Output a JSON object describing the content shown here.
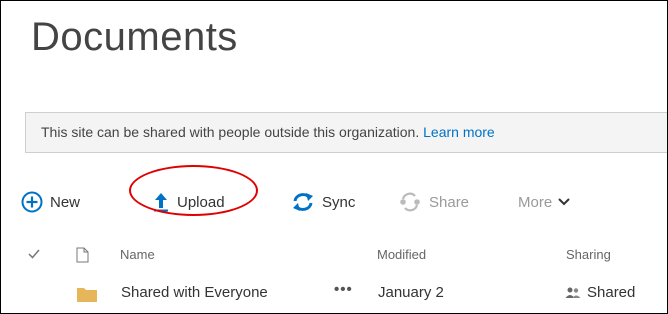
{
  "page": {
    "title": "Documents"
  },
  "banner": {
    "message": "This site can be shared with people outside this organization.",
    "link_label": "Learn more"
  },
  "toolbar": {
    "new_label": "New",
    "upload_label": "Upload",
    "sync_label": "Sync",
    "share_label": "Share",
    "more_label": "More"
  },
  "list": {
    "columns": {
      "name": "Name",
      "modified": "Modified",
      "sharing": "Sharing"
    },
    "rows": [
      {
        "name": "Shared with Everyone",
        "actions": "•••",
        "modified": "January 2",
        "sharing": "Shared"
      }
    ]
  },
  "colors": {
    "accent": "#0072c6",
    "highlight": "#e00000",
    "folder": "#e8b65a",
    "disabled": "#9a9a9a"
  },
  "icons": {
    "new": "plus-circle-icon",
    "upload": "upload-arrow-icon",
    "sync": "sync-icon",
    "share": "share-icon",
    "more": "chevron-down-icon",
    "check": "check-icon",
    "file_type": "document-icon",
    "folder": "folder-icon",
    "shared": "people-icon"
  }
}
